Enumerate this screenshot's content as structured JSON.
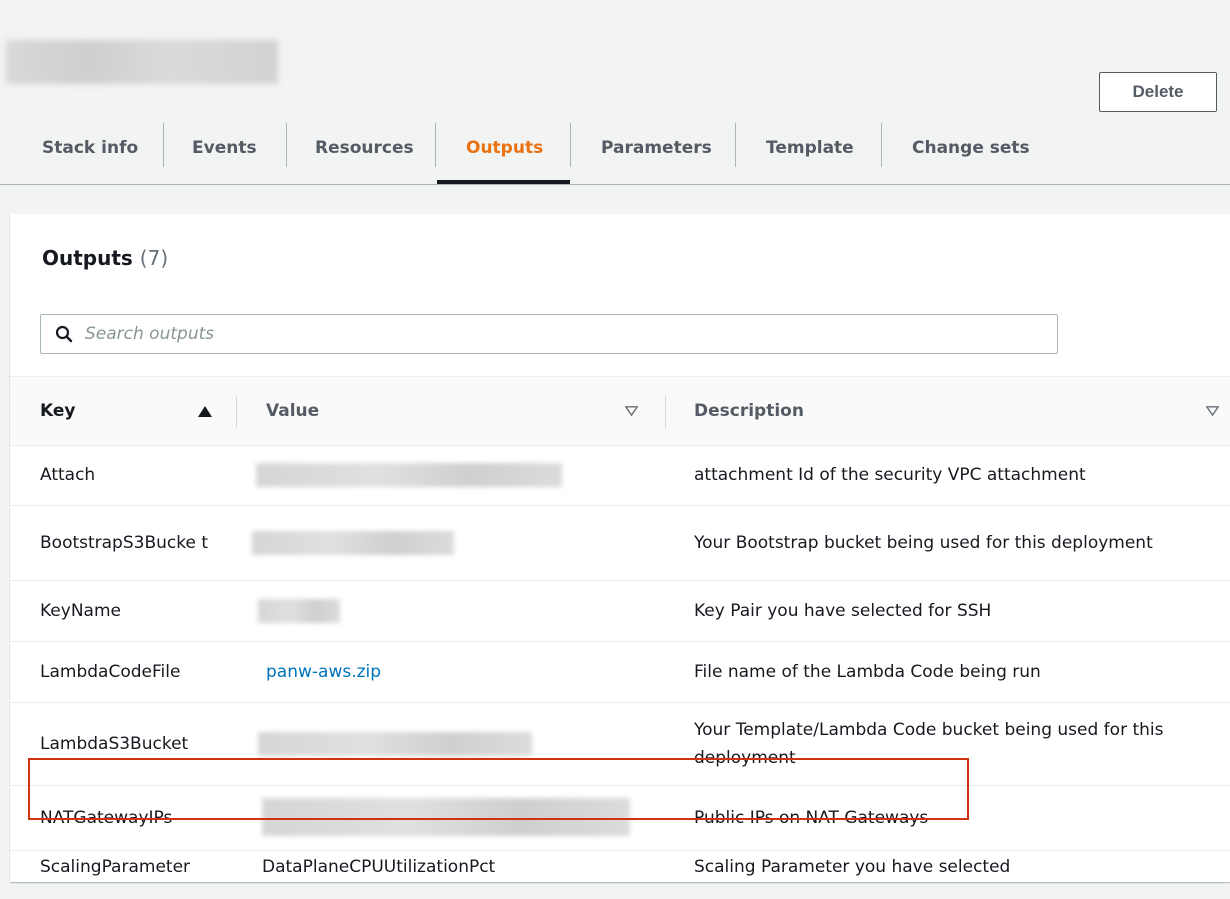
{
  "header": {
    "delete_label": "Delete"
  },
  "tabs": [
    {
      "label": "Stack info"
    },
    {
      "label": "Events"
    },
    {
      "label": "Resources"
    },
    {
      "label": "Outputs"
    },
    {
      "label": "Parameters"
    },
    {
      "label": "Template"
    },
    {
      "label": "Change sets"
    }
  ],
  "active_tab": "Outputs",
  "outputs": {
    "title": "Outputs",
    "count": "(7)",
    "search_placeholder": "Search outputs",
    "columns": {
      "key": "Key",
      "value": "Value",
      "description": "Description"
    },
    "rows": [
      {
        "key": "Attach",
        "value": "",
        "description": "attachment Id of the security VPC attachment"
      },
      {
        "key": "BootstrapS3Bucke t",
        "value": "",
        "description": "Your Bootstrap bucket being used for this deployment"
      },
      {
        "key": "KeyName",
        "value": "",
        "description": "Key Pair you have selected for SSH"
      },
      {
        "key": "LambdaCodeFile",
        "value": "panw-aws.zip",
        "description": "File name of the Lambda Code being run"
      },
      {
        "key": "LambdaS3Bucket",
        "value": "",
        "description": "Your Template/Lambda Code bucket being used for this deployment"
      },
      {
        "key": "NATGatewayIPs",
        "value": "",
        "description": "Public IPs on NAT Gateways"
      },
      {
        "key": "ScalingParameter",
        "value": "DataPlaneCPUUtilizationPct",
        "description": "Scaling Parameter you have selected"
      }
    ]
  },
  "colors": {
    "accent": "#ec7211",
    "link": "#0073bb",
    "highlight": "#d13212"
  }
}
